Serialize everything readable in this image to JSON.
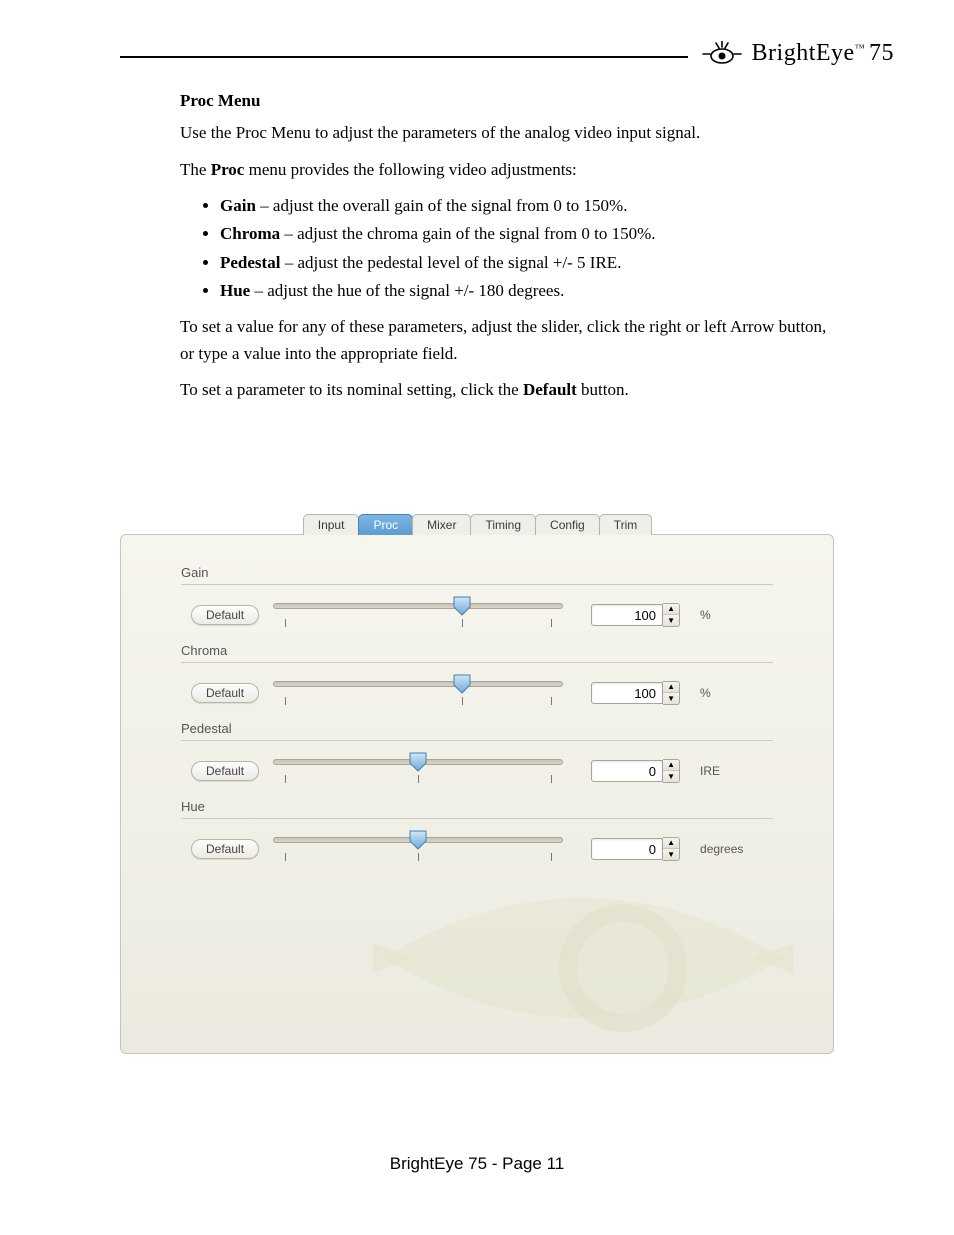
{
  "brand": {
    "name": "BrightEye",
    "model": "75"
  },
  "doc": {
    "heading": "Proc Menu",
    "intro": "Use the Proc Menu to adjust the parameters of the analog video input signal.",
    "lead_pre": "The ",
    "lead_bold": "Proc",
    "lead_post": " menu provides the following video adjustments:",
    "bullets": [
      {
        "b": "Gain",
        "t": " – adjust the overall gain of the signal from 0 to 150%."
      },
      {
        "b": "Chroma",
        "t": " – adjust the chroma gain of the signal from 0 to 150%."
      },
      {
        "b": "Pedestal",
        "t": " – adjust the pedestal level of the signal +/- 5 IRE."
      },
      {
        "b": "Hue",
        "t": " – adjust the hue of the signal +/- 180 degrees."
      }
    ],
    "set_value": "To set a value for any of these parameters, adjust the slider, click the right or left Arrow button, or type a value into the appropriate field.",
    "set_default_pre": "To set a parameter to its nominal setting, click the ",
    "set_default_bold": "Default",
    "set_default_post": " button."
  },
  "tabs": [
    "Input",
    "Proc",
    "Mixer",
    "Timing",
    "Config",
    "Trim"
  ],
  "active_tab": "Proc",
  "default_label": "Default",
  "params": [
    {
      "name": "Gain",
      "value": "100",
      "unit": "%",
      "thumb_pct": 65,
      "ticks": [
        4,
        65,
        96
      ]
    },
    {
      "name": "Chroma",
      "value": "100",
      "unit": "%",
      "thumb_pct": 65,
      "ticks": [
        4,
        65,
        96
      ]
    },
    {
      "name": "Pedestal",
      "value": "0",
      "unit": "IRE",
      "thumb_pct": 50,
      "ticks": [
        4,
        50,
        96
      ]
    },
    {
      "name": "Hue",
      "value": "0",
      "unit": "degrees",
      "thumb_pct": 50,
      "ticks": [
        4,
        50,
        96
      ]
    }
  ],
  "footer": "BrightEye 75 - Page 11"
}
